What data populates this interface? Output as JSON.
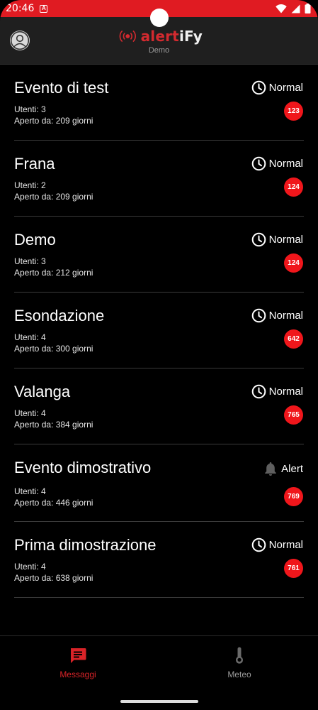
{
  "status_bar": {
    "time": "20:46",
    "notif_glyph": "A"
  },
  "app_bar": {
    "logo": {
      "part1": "alert",
      "part2": "iFy"
    },
    "subtitle": "Demo"
  },
  "events": [
    {
      "title": "Evento di test",
      "users": "Utenti: 3",
      "open_since": "Aperto da: 209 giorni",
      "status": "Normal",
      "status_icon": "clock-icon",
      "count": "123"
    },
    {
      "title": "Frana",
      "users": "Utenti: 2",
      "open_since": "Aperto da: 209 giorni",
      "status": "Normal",
      "status_icon": "clock-icon",
      "count": "124"
    },
    {
      "title": "Demo",
      "users": "Utenti: 3",
      "open_since": "Aperto da: 212 giorni",
      "status": "Normal",
      "status_icon": "clock-icon",
      "count": "124"
    },
    {
      "title": "Esondazione",
      "users": "Utenti: 4",
      "open_since": "Aperto da: 300 giorni",
      "status": "Normal",
      "status_icon": "clock-icon",
      "count": "642"
    },
    {
      "title": "Valanga",
      "users": "Utenti: 4",
      "open_since": "Aperto da: 384 giorni",
      "status": "Normal",
      "status_icon": "clock-icon",
      "count": "765"
    },
    {
      "title": "Evento dimostrativo",
      "users": "Utenti: 4",
      "open_since": "Aperto da: 446 giorni",
      "status": "Alert",
      "status_icon": "bell-icon",
      "count": "769"
    },
    {
      "title": "Prima dimostrazione",
      "users": "Utenti: 4",
      "open_since": "Aperto da: 638 giorni",
      "status": "Normal",
      "status_icon": "clock-icon",
      "count": "761"
    }
  ],
  "bottom_nav": {
    "messaggi": {
      "label": "Messaggi",
      "icon": "message-icon",
      "active": true
    },
    "meteo": {
      "label": "Meteo",
      "icon": "thermometer-icon",
      "active": false
    }
  },
  "colors": {
    "accent": "#d92328",
    "status_bar": "#e01b22",
    "badge": "#f0161b",
    "app_bar": "#1f1f1f"
  }
}
